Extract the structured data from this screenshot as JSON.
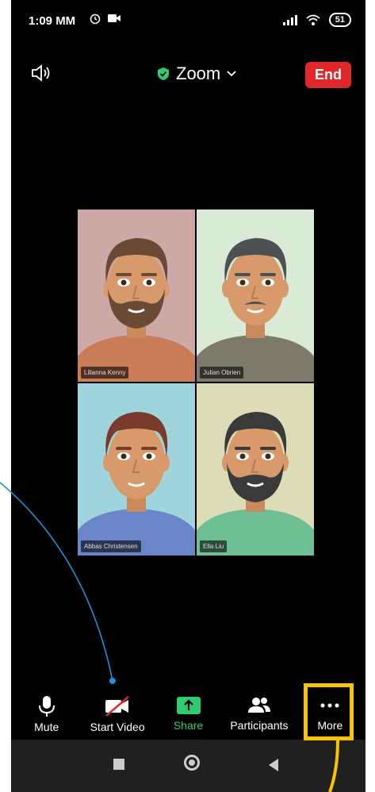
{
  "status_bar": {
    "time": "1:09 MM",
    "battery": "51"
  },
  "header": {
    "title": "Zoom",
    "end_label": "End"
  },
  "participants": [
    {
      "name": "Lilianna Kenny",
      "bg": "#cca8a6",
      "shirt": "#c97c56",
      "hair": "#6a4a35",
      "beard": true,
      "mustache": false,
      "active": false
    },
    {
      "name": "Julian Obrien",
      "bg": "#d9ead6",
      "shirt": "#7d7a6c",
      "hair": "#4e5154",
      "beard": false,
      "mustache": true,
      "active": true
    },
    {
      "name": "Abbas Christensen",
      "bg": "#9fd4dc",
      "shirt": "#6a86c9",
      "hair": "#7a3a2c",
      "beard": false,
      "mustache": false,
      "active": false
    },
    {
      "name": "Ella Liu",
      "bg": "#dcdcb6",
      "shirt": "#6fbf96",
      "hair": "#3a3a3a",
      "beard": true,
      "mustache": false,
      "active": false
    }
  ],
  "toolbar": {
    "mute": "Mute",
    "start_video": "Start Video",
    "share": "Share",
    "participants": "Participants",
    "more": "More"
  },
  "colors": {
    "end": "#e02828",
    "share": "#2ecc71",
    "highlight": "#f9c300",
    "pointer_line": "#1f8fd1"
  }
}
